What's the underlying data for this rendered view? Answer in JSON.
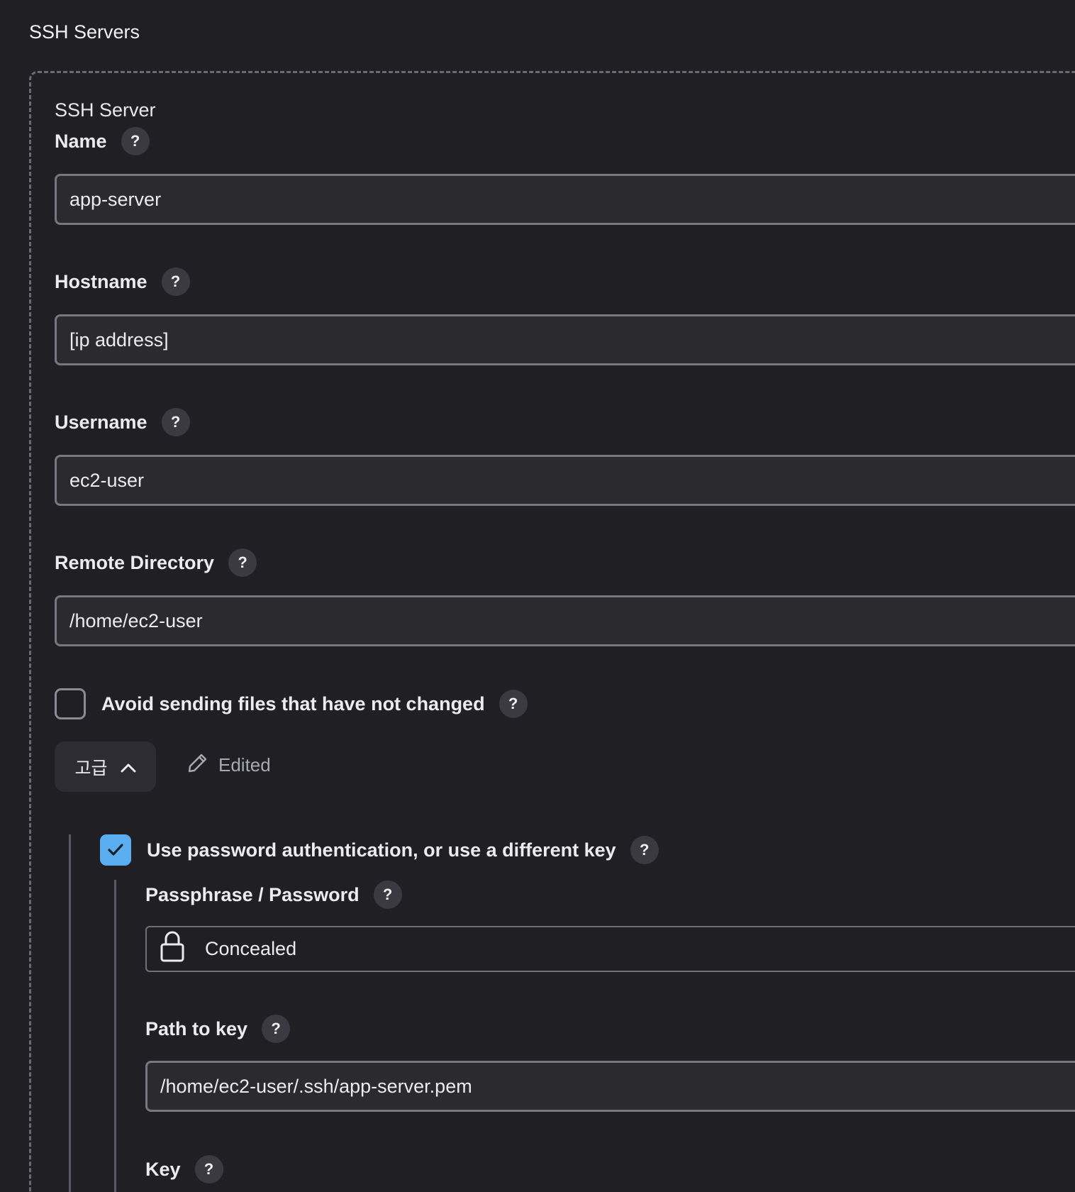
{
  "section": {
    "title": "SSH Servers"
  },
  "server": {
    "block_title": "SSH Server",
    "name": {
      "label": "Name",
      "value": "app-server"
    },
    "hostname": {
      "label": "Hostname",
      "value": "[ip address]"
    },
    "username": {
      "label": "Username",
      "value": "ec2-user"
    },
    "remote_directory": {
      "label": "Remote Directory",
      "value": "/home/ec2-user"
    },
    "avoid_unchanged": {
      "label": "Avoid sending files that have not changed",
      "checked": false
    },
    "advanced": {
      "label": "고급",
      "expanded": true,
      "icon": "chevron-up-icon"
    },
    "edited": {
      "label": "Edited",
      "icon": "pencil-icon"
    },
    "password_auth": {
      "label": "Use password authentication, or use a different key",
      "checked": true
    },
    "passphrase": {
      "label": "Passphrase / Password",
      "value": "Concealed",
      "icon": "lock-icon"
    },
    "path_to_key": {
      "label": "Path to key",
      "value": "/home/ec2-user/.ssh/app-server.pem"
    },
    "key": {
      "label": "Key"
    }
  },
  "help_symbol": "?",
  "colors": {
    "background": "#1f1f24",
    "input_background": "#2a2a2f",
    "checkbox_accent": "#5aaef0",
    "help_badge": "#3a3a40"
  }
}
